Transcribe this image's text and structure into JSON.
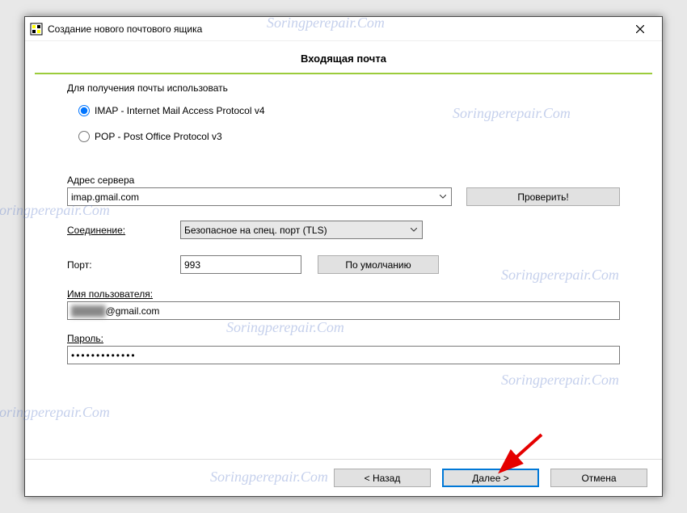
{
  "titlebar": {
    "title": "Создание нового почтового ящика"
  },
  "header": {
    "section_title": "Входящая почта"
  },
  "protocol_group": {
    "legend": "Для получения почты использовать",
    "imap_label": "IMAP - Internet Mail Access Protocol v4",
    "pop_label": "POP  -  Post Office Protocol v3"
  },
  "server": {
    "label": "Адрес сервера",
    "value": "imap.gmail.com",
    "check_btn": "Проверить!"
  },
  "connection": {
    "label": "Соединение:",
    "value": "Безопасное на спец. порт (TLS)"
  },
  "port": {
    "label": "Порт:",
    "value": "993",
    "default_btn": "По умолчанию"
  },
  "username": {
    "label": "Имя пользователя:",
    "prefix_hidden": "█████",
    "suffix": "@gmail.com"
  },
  "password": {
    "label": "Пароль:",
    "value": "•••••••••••••"
  },
  "footer": {
    "back": "<  Назад",
    "next": "Далее  >",
    "cancel": "Отмена"
  },
  "watermark": "Soringperepair.Com"
}
